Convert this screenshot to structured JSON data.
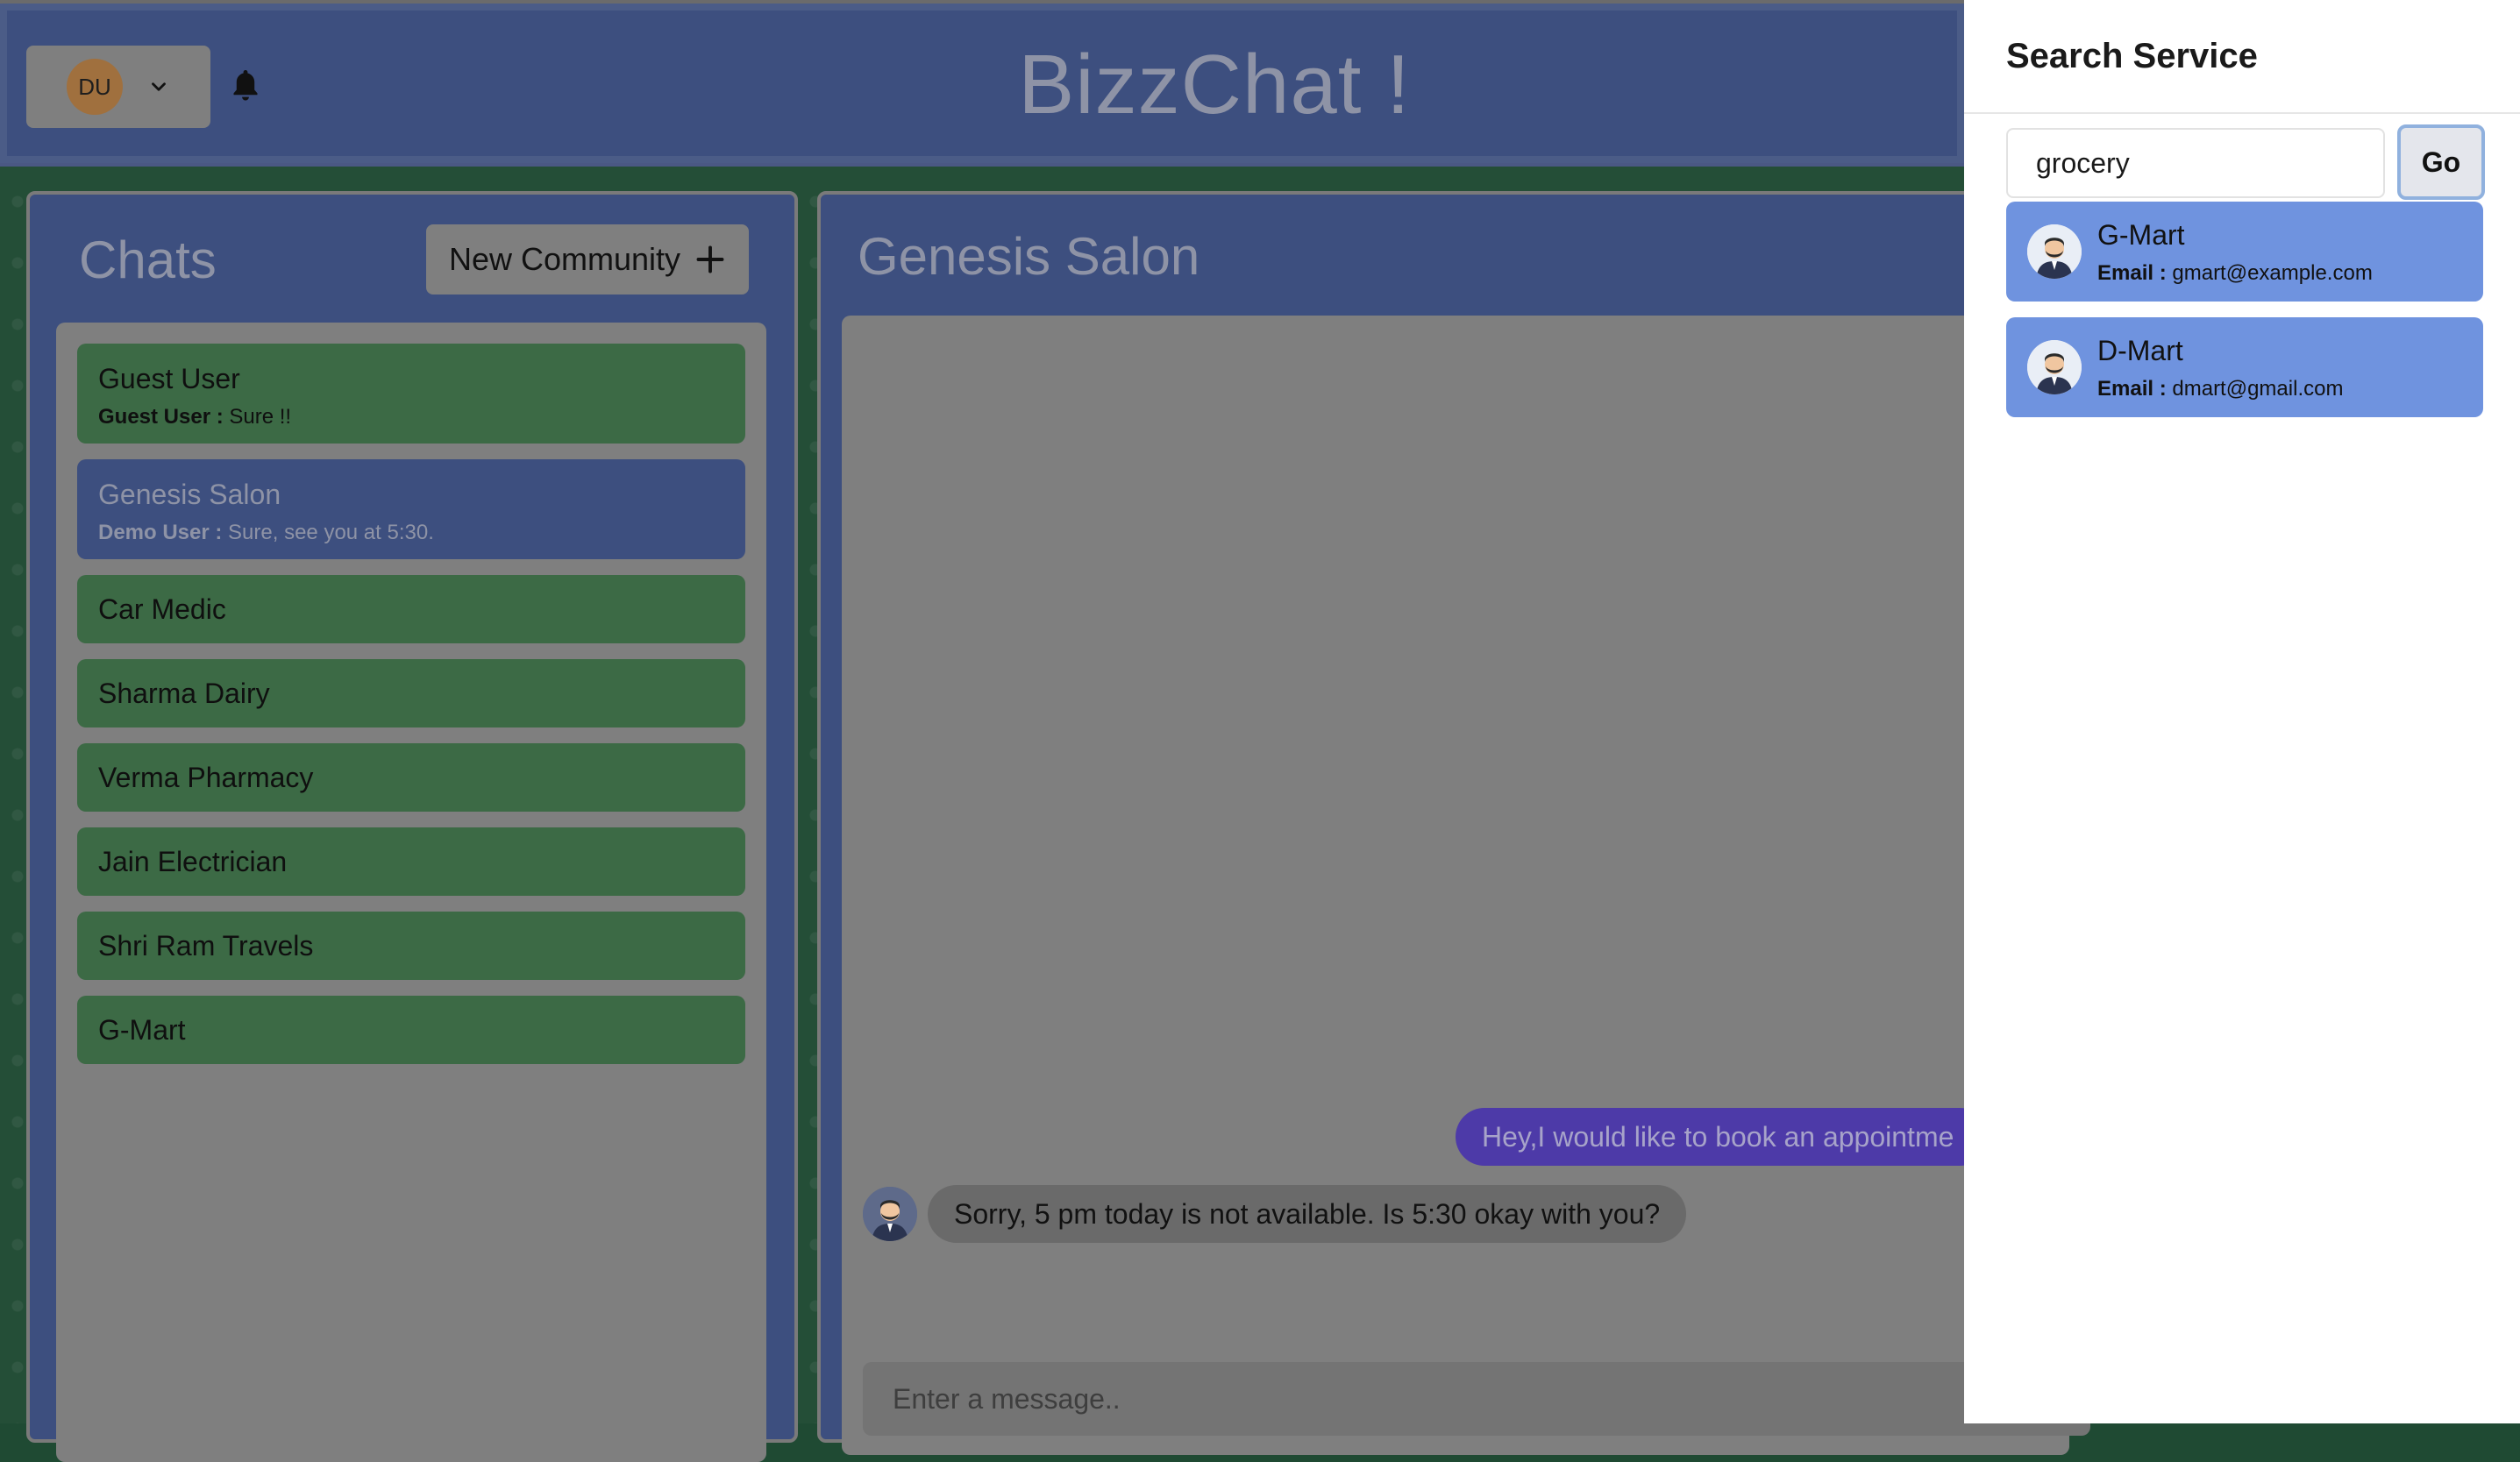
{
  "app": {
    "title": "BizzChat !"
  },
  "header": {
    "avatar_initials": "DU"
  },
  "chats": {
    "title": "Chats",
    "new_community_label": "New Community",
    "items": [
      {
        "name": "Guest User",
        "last_sender": "Guest User",
        "last_message": "Sure !!",
        "active": false
      },
      {
        "name": "Genesis Salon",
        "last_sender": "Demo User",
        "last_message": "Sure, see you at 5:30.",
        "active": true
      },
      {
        "name": "Car Medic"
      },
      {
        "name": "Sharma Dairy"
      },
      {
        "name": "Verma Pharmacy"
      },
      {
        "name": "Jain Electrician"
      },
      {
        "name": "Shri Ram Travels"
      },
      {
        "name": "G-Mart"
      }
    ]
  },
  "conversation": {
    "title": "Genesis Salon",
    "messages": [
      {
        "side": "right",
        "text": "Hey,I would like to book an appointme"
      },
      {
        "side": "left",
        "text": "Sorry, 5 pm today is not available. Is 5:30 okay with you?"
      }
    ],
    "input_placeholder": "Enter a message.."
  },
  "search_drawer": {
    "title": "Search Service",
    "query": "grocery",
    "go_label": "Go",
    "email_label": "Email :",
    "results": [
      {
        "name": "G-Mart",
        "email": "gmart@example.com"
      },
      {
        "name": "D-Mart",
        "email": "dmart@gmail.com"
      }
    ]
  }
}
